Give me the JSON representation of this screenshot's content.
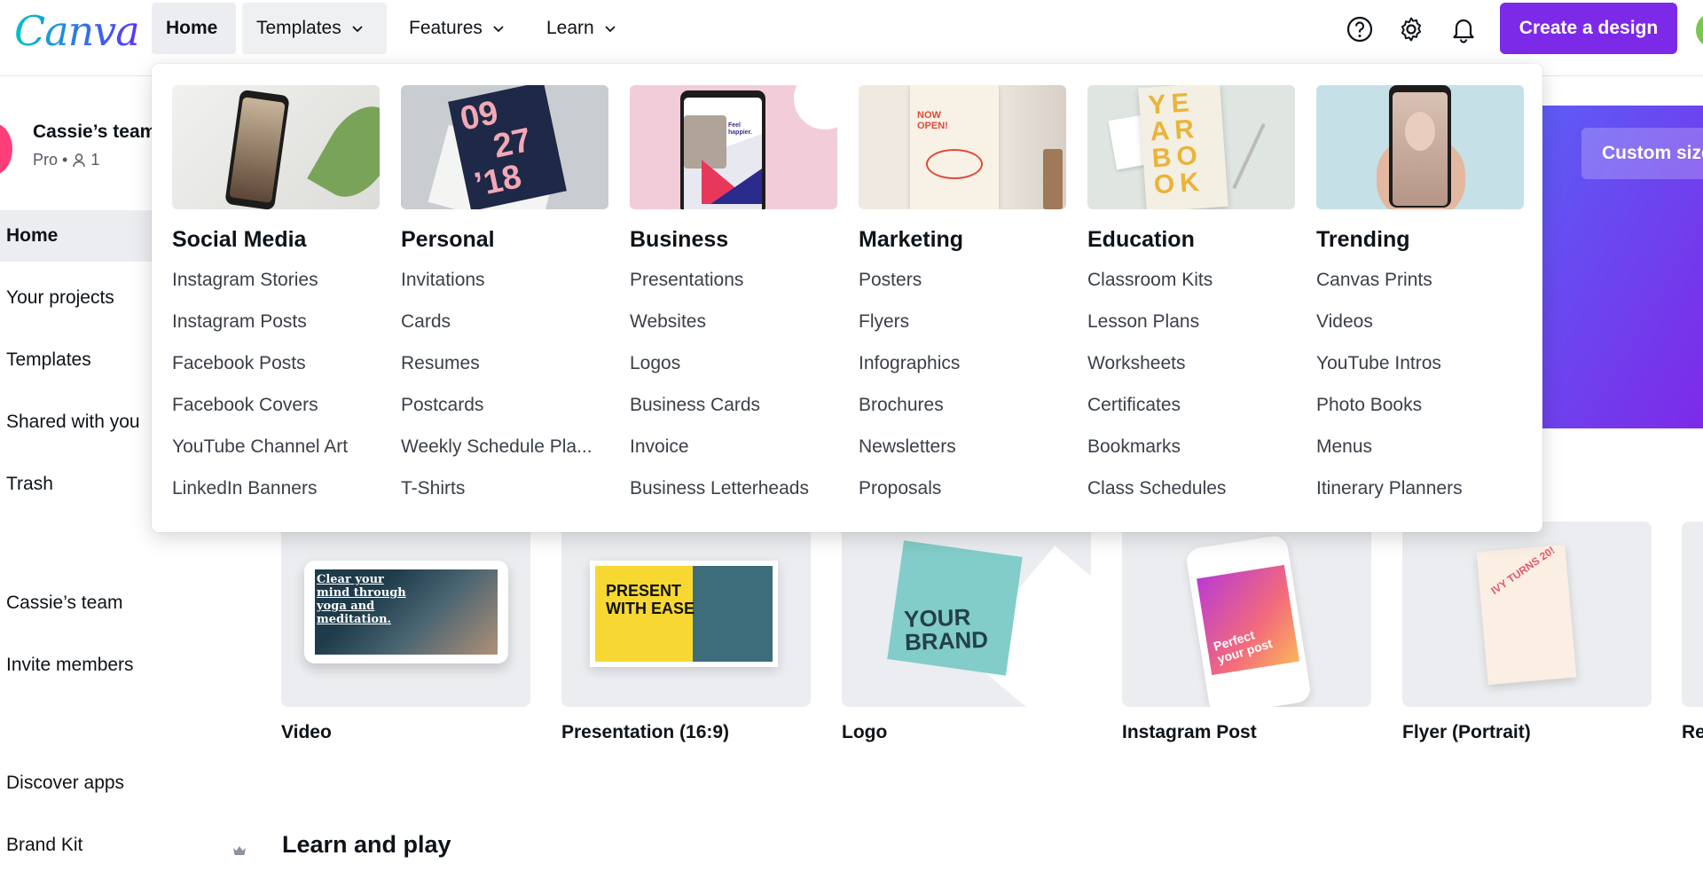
{
  "brand": {
    "logo_text": "Canva",
    "accent": "#7d2ae8"
  },
  "topnav": {
    "home": "Home",
    "templates": "Templates",
    "features": "Features",
    "learn": "Learn",
    "create_button": "Create a design"
  },
  "sidebar": {
    "team_name": "Cassie’s team",
    "team_plan": "Pro •",
    "member_count": "1",
    "items": [
      {
        "label": "Home"
      },
      {
        "label": "Your projects"
      },
      {
        "label": "Templates"
      },
      {
        "label": "Shared with you"
      },
      {
        "label": "Trash"
      },
      {
        "label": "Cassie’s team"
      },
      {
        "label": "Invite members"
      },
      {
        "label": "Discover apps"
      },
      {
        "label": "Brand Kit"
      }
    ]
  },
  "banner": {
    "button": "Custom size"
  },
  "design_types": [
    {
      "label": "Video",
      "art": "Clear your mind through yoga and meditation."
    },
    {
      "label": "Presentation (16:9)",
      "art": "PRESENT WITH EASE"
    },
    {
      "label": "Logo",
      "art": "YOUR BRAND"
    },
    {
      "label": "Instagram Post",
      "art": "Perfect your post"
    },
    {
      "label": "Flyer (Portrait)",
      "art": "IVY TURNS 20!"
    },
    {
      "label": "Re"
    }
  ],
  "section_title": "Learn and play",
  "dropdown": {
    "columns": [
      {
        "title": "Social Media",
        "items": [
          "Instagram Stories",
          "Instagram Posts",
          "Facebook Posts",
          "Facebook Covers",
          "YouTube Channel Art",
          "LinkedIn Banners"
        ]
      },
      {
        "title": "Personal",
        "art": [
          "09",
          "27",
          "’18"
        ],
        "items": [
          "Invitations",
          "Cards",
          "Resumes",
          "Postcards",
          "Weekly Schedule Pla...",
          "T-Shirts"
        ]
      },
      {
        "title": "Business",
        "art": "Feel happier.",
        "items": [
          "Presentations",
          "Websites",
          "Logos",
          "Business Cards",
          "Invoice",
          "Business Letterheads"
        ]
      },
      {
        "title": "Marketing",
        "art": "NOW OPEN!",
        "items": [
          "Posters",
          "Flyers",
          "Infographics",
          "Brochures",
          "Newsletters",
          "Proposals"
        ]
      },
      {
        "title": "Education",
        "art": "YEARBOOK",
        "items": [
          "Classroom Kits",
          "Lesson Plans",
          "Worksheets",
          "Certificates",
          "Bookmarks",
          "Class Schedules"
        ]
      },
      {
        "title": "Trending",
        "items": [
          "Canvas Prints",
          "Videos",
          "YouTube Intros",
          "Photo Books",
          "Menus",
          "Itinerary Planners"
        ]
      }
    ]
  }
}
